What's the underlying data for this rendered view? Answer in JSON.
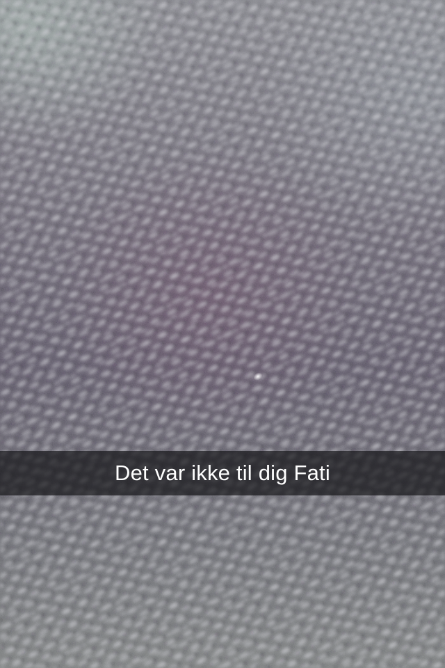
{
  "snap": {
    "caption": "Det var ikke til dig Fati"
  },
  "colors": {
    "caption_bar": "#121214",
    "caption_text": "#ffffff",
    "fabric_base": "#6a6873"
  }
}
